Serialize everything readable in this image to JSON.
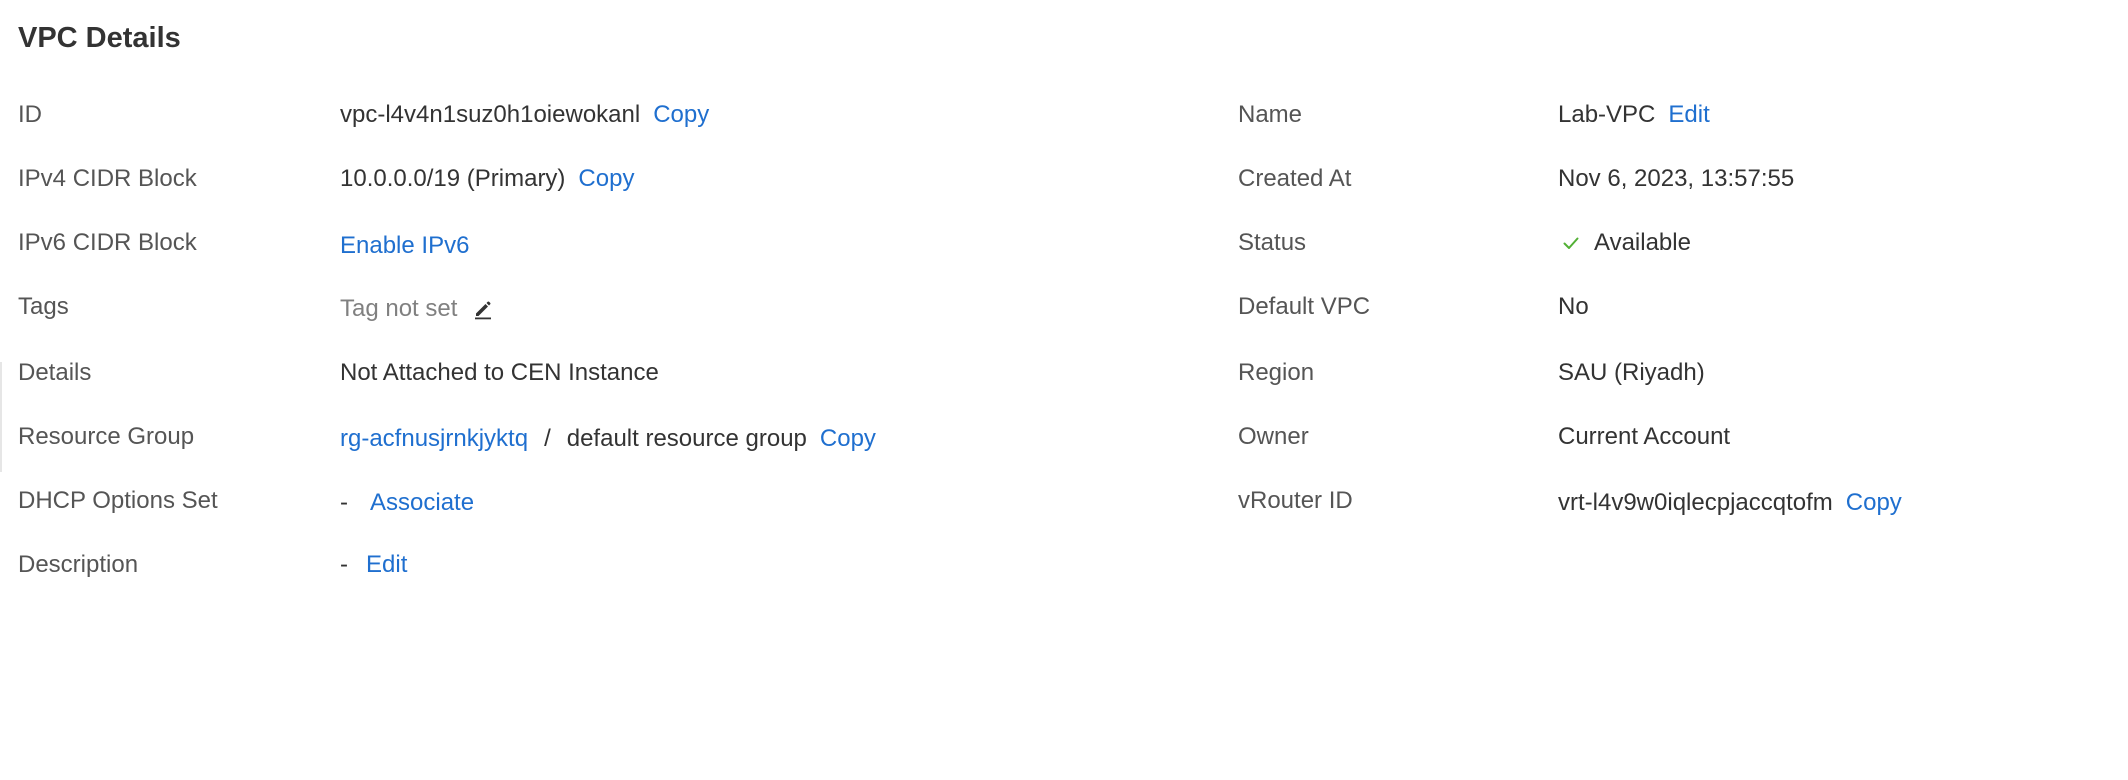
{
  "header": {
    "title": "VPC Details"
  },
  "left": {
    "id": {
      "label": "ID",
      "value": "vpc-l4v4n1suz0h1oiewokanl",
      "action": "Copy"
    },
    "ipv4": {
      "label": "IPv4 CIDR Block",
      "value": "10.0.0.0/19 (Primary)",
      "action": "Copy"
    },
    "ipv6": {
      "label": "IPv6 CIDR Block",
      "action": "Enable IPv6"
    },
    "tags": {
      "label": "Tags",
      "value": "Tag not set",
      "icon": "pencil-icon"
    },
    "details": {
      "label": "Details",
      "value": "Not Attached to CEN Instance"
    },
    "resource_group": {
      "label": "Resource Group",
      "link": "rg-acfnusjrnkjyktq",
      "separator": "/",
      "value": "default resource group",
      "action": "Copy"
    },
    "dhcp": {
      "label": "DHCP Options Set",
      "value": "-",
      "action": "Associate"
    },
    "description": {
      "label": "Description",
      "value": "-",
      "action": "Edit"
    }
  },
  "right": {
    "name": {
      "label": "Name",
      "value": "Lab-VPC",
      "action": "Edit"
    },
    "created_at": {
      "label": "Created At",
      "value": "Nov 6, 2023, 13:57:55"
    },
    "status": {
      "label": "Status",
      "value": "Available",
      "icon": "check-icon",
      "icon_color": "#52b035"
    },
    "default_vpc": {
      "label": "Default VPC",
      "value": "No"
    },
    "region": {
      "label": "Region",
      "value": "SAU (Riyadh)"
    },
    "owner": {
      "label": "Owner",
      "value": "Current Account"
    },
    "vrouter": {
      "label": "vRouter ID",
      "value": "vrt-l4v9w0iqlecpjaccqtofm",
      "action": "Copy"
    }
  },
  "colors": {
    "link": "#1f6fcf",
    "label": "#555555",
    "text": "#333333",
    "muted": "#808080"
  }
}
